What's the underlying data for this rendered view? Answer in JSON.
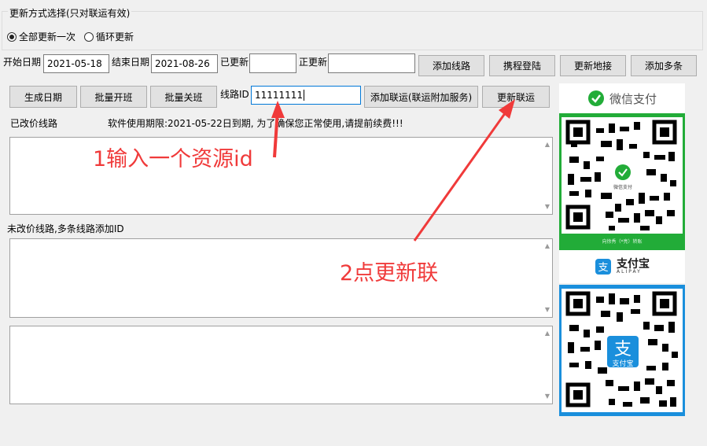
{
  "update_mode": {
    "group_title": "更新方式选择(只对联运有效)",
    "options": [
      {
        "label": "全部更新一次",
        "selected": true
      },
      {
        "label": "循环更新",
        "selected": false
      }
    ]
  },
  "row1": {
    "start_date_label": "开始日期",
    "start_date_value": "2021-05-18",
    "end_date_label": "结束日期",
    "end_date_value": "2021-08-26",
    "updated_label": "已更新",
    "updated_value": "",
    "updating_label": "正更新",
    "updating_value": "",
    "buttons": [
      "添加线路",
      "携程登陆",
      "更新地接",
      "添加多条"
    ]
  },
  "row2": {
    "buttons_left": [
      "生成日期",
      "批量开班",
      "批量关班"
    ],
    "route_id_label": "线路ID",
    "route_id_value": "11111111",
    "add_lianyun_button": "添加联运(联运附加服务)",
    "update_lianyun_button": "更新联运"
  },
  "status": {
    "changed_label": "已改价线路",
    "expiry_notice": "软件使用期限:2021-05-22日到期,    为了确保您正常使用,请提前续费!!!"
  },
  "unchanged_label": "未改价线路,多条线路添加ID",
  "annotations": {
    "step1": "1输入一个资源id",
    "step2": "2点更新联"
  },
  "payment": {
    "wechat_title": "微信支付",
    "wechat_badge": "微信支付",
    "wechat_caption": "向徐秀（*亮）转账",
    "alipay_title": "支付宝",
    "alipay_subtitle": "ALIPAY",
    "alipay_badge": "支付宝",
    "colors": {
      "wechat": "#22ac38",
      "alipay": "#1a8fdc",
      "annotation": "#f03a3a"
    }
  }
}
